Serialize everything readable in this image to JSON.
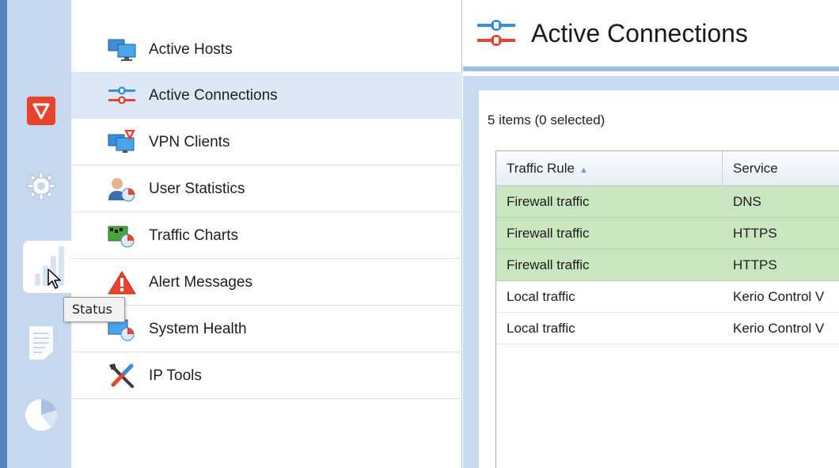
{
  "rail": {
    "items": [
      {
        "name": "security",
        "icon": "shield-icon"
      },
      {
        "name": "configuration",
        "icon": "gear-icon"
      },
      {
        "name": "status",
        "icon": "bar-chart-icon"
      },
      {
        "name": "logs",
        "icon": "document-icon"
      },
      {
        "name": "reports",
        "icon": "pie-chart-icon"
      }
    ],
    "tooltip": "Status"
  },
  "nav": {
    "items": [
      {
        "label": "Active Hosts",
        "icon": "computers-icon"
      },
      {
        "label": "Active Connections",
        "icon": "connections-icon",
        "selected": true
      },
      {
        "label": "VPN Clients",
        "icon": "vpn-clients-icon"
      },
      {
        "label": "User Statistics",
        "icon": "user-statistics-icon"
      },
      {
        "label": "Traffic Charts",
        "icon": "traffic-charts-icon"
      },
      {
        "label": "Alert Messages",
        "icon": "alert-icon"
      },
      {
        "label": "System Health",
        "icon": "system-health-icon"
      },
      {
        "label": "IP Tools",
        "icon": "tools-icon"
      }
    ]
  },
  "content": {
    "title": "Active Connections",
    "item_count": "5 items (0 selected)",
    "columns": [
      "Traffic Rule",
      "Service"
    ],
    "rows": [
      {
        "traffic_rule": "Firewall traffic",
        "service": "DNS",
        "highlight": true
      },
      {
        "traffic_rule": "Firewall traffic",
        "service": "HTTPS",
        "highlight": true
      },
      {
        "traffic_rule": "Firewall traffic",
        "service": "HTTPS",
        "highlight": true
      },
      {
        "traffic_rule": "Local traffic",
        "service": "Kerio Control V",
        "highlight": false
      },
      {
        "traffic_rule": "Local traffic",
        "service": "Kerio Control V",
        "highlight": false
      }
    ]
  },
  "colors": {
    "rail_bg": "#c6d7ee",
    "accent_blue": "#5684c1",
    "selected_row": "#dde8f7",
    "firewall_row": "#c9e6c0",
    "shield_red": "#e8432f"
  }
}
